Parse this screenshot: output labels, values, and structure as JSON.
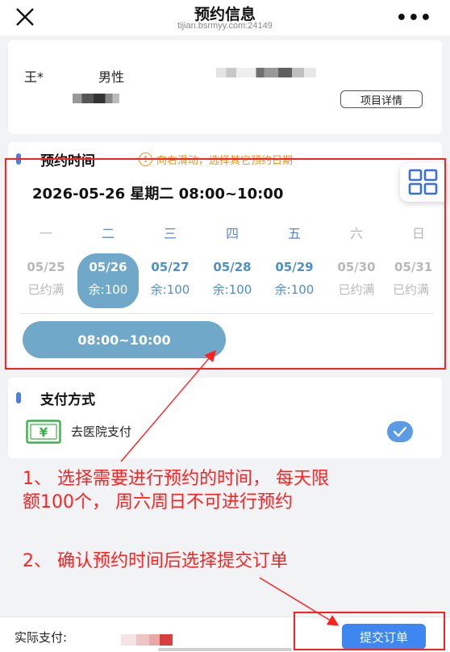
{
  "header": {
    "title": "预约信息",
    "subtitle": "tijian.bsrmyy.com:24149"
  },
  "patient": {
    "name": "王*",
    "gender": "男性",
    "detail_button": "项目详情"
  },
  "schedule": {
    "section_title": "预约时间",
    "hint": "向右滑动，选择其它预约日期",
    "selected_datetime": "2026-05-26 星期二 08:00~10:00",
    "weekdays": [
      "一",
      "二",
      "三",
      "四",
      "五",
      "六",
      "日"
    ],
    "days": [
      {
        "date": "05/25",
        "status": "已约满"
      },
      {
        "date": "05/26",
        "status": "余:100"
      },
      {
        "date": "05/27",
        "status": "余:100"
      },
      {
        "date": "05/28",
        "status": "余:100"
      },
      {
        "date": "05/29",
        "status": "余:100"
      },
      {
        "date": "05/30",
        "status": "已约满"
      },
      {
        "date": "05/31",
        "status": "已约满"
      }
    ],
    "selected_day_index": 1,
    "time_slot": "08:00~10:00"
  },
  "payment": {
    "section_title": "支付方式",
    "option_label": "去医院支付",
    "option_icon": "¥"
  },
  "annotations": {
    "note1_line1": "1、 选择需要进行预约的时间， 每天限",
    "note1_line2": "额100个， 周六周日不可进行预约",
    "note2": "2、 确认预约时间后选择提交订单"
  },
  "footer": {
    "actual_pay_label": "实际支付:",
    "submit_button": "提交订单"
  },
  "colors": {
    "accent_blue": "#3e87f0",
    "selected_teal": "#6fa8c8",
    "hint_orange": "#e9941f",
    "annotation_red": "#ff2222"
  }
}
